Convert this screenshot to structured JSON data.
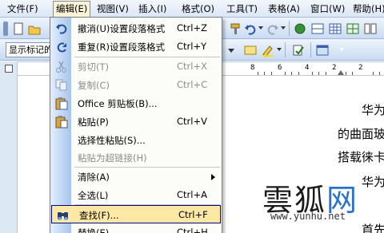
{
  "menubar": {
    "items": [
      "文件(F)",
      "编辑(E)",
      "视图(V)",
      "插入(I)",
      "格式(O)",
      "工具(T)",
      "表格(A)",
      "窗口(W)",
      "帮助(H)"
    ],
    "active_index": 1
  },
  "toolbar": {
    "style_combo_value": "显示标记的"
  },
  "ruler": {
    "numbers": [
      "8",
      "6",
      "4",
      "2",
      "2"
    ]
  },
  "edit_menu": {
    "items": [
      {
        "label": "撤消(U)设置段落格式",
        "shortcut": "Ctrl+Z",
        "icon": "undo-icon",
        "enabled": true
      },
      {
        "label": "重复(R)设置段落格式",
        "shortcut": "Ctrl+Y",
        "icon": "redo-icon",
        "enabled": true
      },
      {
        "label": "剪切(T)",
        "shortcut": "Ctrl+X",
        "icon": "scissors-icon",
        "enabled": false
      },
      {
        "label": "复制(C)",
        "shortcut": "Ctrl+C",
        "icon": "copy-icon",
        "enabled": false
      },
      {
        "label": "Office 剪贴板(B)...",
        "shortcut": "",
        "icon": "clipboard-icon",
        "enabled": true
      },
      {
        "label": "粘贴(P)",
        "shortcut": "Ctrl+V",
        "icon": "paste-icon",
        "enabled": true
      },
      {
        "label": "选择性粘贴(S)...",
        "shortcut": "",
        "icon": "",
        "enabled": true
      },
      {
        "label": "粘贴为超链接(H)",
        "shortcut": "",
        "icon": "",
        "enabled": false
      },
      {
        "label": "清除(A)",
        "shortcut": "",
        "icon": "",
        "enabled": true,
        "submenu": true
      },
      {
        "label": "全选(L)",
        "shortcut": "Ctrl+A",
        "icon": "",
        "enabled": true
      },
      {
        "label": "查找(F)...",
        "shortcut": "Ctrl+F",
        "icon": "binoculars-icon",
        "enabled": true,
        "highlighted": true
      },
      {
        "label": "替换(E)...",
        "shortcut": "Ctrl+H",
        "icon": "",
        "enabled": true
      }
    ]
  },
  "document": {
    "lines": [
      "华为",
      "的曲面玻",
      "搭载徕卡",
      "华为",
      "首先"
    ]
  },
  "watermark": {
    "title_black": "雲狐",
    "title_blue": "网",
    "url": "www.yunhu.net"
  },
  "colors": {
    "accent": "#2b73c9",
    "highlight": "#fde8a5",
    "menubar_bg": "#dbe7f7"
  }
}
